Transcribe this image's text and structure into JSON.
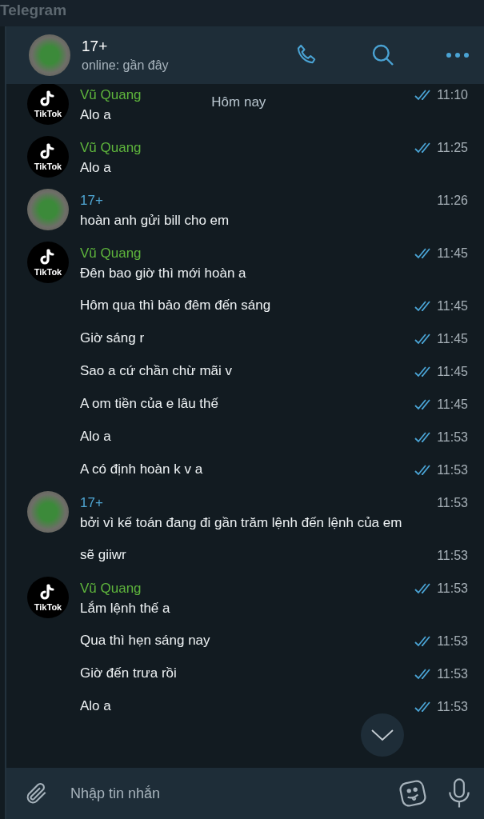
{
  "window": {
    "title": "Telegram"
  },
  "header": {
    "name": "17+",
    "status": "online: gần đây"
  },
  "date_chip": "Hôm nay",
  "groups": [
    {
      "sender": "Vũ Quang",
      "color": "#5eb53c",
      "avatar": {
        "kind": "tiktok",
        "label": "TikTok"
      },
      "messages": [
        {
          "text": "Alo a",
          "time": "11:10",
          "read": true
        }
      ]
    },
    {
      "sender": "Vũ Quang",
      "color": "#5eb53c",
      "avatar": {
        "kind": "tiktok",
        "label": "TikTok"
      },
      "messages": [
        {
          "text": "Alo a",
          "time": "11:25",
          "read": true
        }
      ]
    },
    {
      "sender": "17+",
      "color": "#4fa6d3",
      "avatar": {
        "kind": "photo"
      },
      "messages": [
        {
          "text": "hoàn anh gửi bill cho em",
          "time": "11:26",
          "read": false
        }
      ]
    },
    {
      "sender": "Vũ Quang",
      "color": "#5eb53c",
      "avatar": {
        "kind": "tiktok",
        "label": "TikTok"
      },
      "messages": [
        {
          "text": "Đên bao giờ thì mới hoàn a",
          "time": "11:45",
          "read": true
        },
        {
          "text": "Hôm qua thì bảo đêm đến sáng",
          "time": "11:45",
          "read": true
        },
        {
          "text": "Giờ sáng r",
          "time": "11:45",
          "read": true
        },
        {
          "text": "Sao a cứ chần chừ mãi v",
          "time": "11:45",
          "read": true
        },
        {
          "text": "A om tiền của e lâu thế",
          "time": "11:45",
          "read": true
        },
        {
          "text": "Alo a",
          "time": "11:53",
          "read": true
        },
        {
          "text": "A có định hoàn k v a",
          "time": "11:53",
          "read": true
        }
      ]
    },
    {
      "sender": "17+",
      "color": "#4fa6d3",
      "avatar": {
        "kind": "photo"
      },
      "messages": [
        {
          "text": "bởi vì kế toán đang đi gần trăm lệnh đến lệnh của em",
          "time": "11:53",
          "read": false
        },
        {
          "text": "sẽ giiwr",
          "time": "11:53",
          "read": false
        }
      ]
    },
    {
      "sender": "Vũ Quang",
      "color": "#5eb53c",
      "avatar": {
        "kind": "tiktok",
        "label": "TikTok"
      },
      "messages": [
        {
          "text": "Lắm lệnh thế a",
          "time": "11:53",
          "read": true
        },
        {
          "text": "Qua thì hẹn sáng nay",
          "time": "11:53",
          "read": true
        },
        {
          "text": "Giờ đến trưa rồi",
          "time": "11:53",
          "read": true
        },
        {
          "text": "Alo a",
          "time": "11:53",
          "read": true
        }
      ]
    }
  ],
  "composer": {
    "placeholder": "Nhập tin nhắn"
  }
}
